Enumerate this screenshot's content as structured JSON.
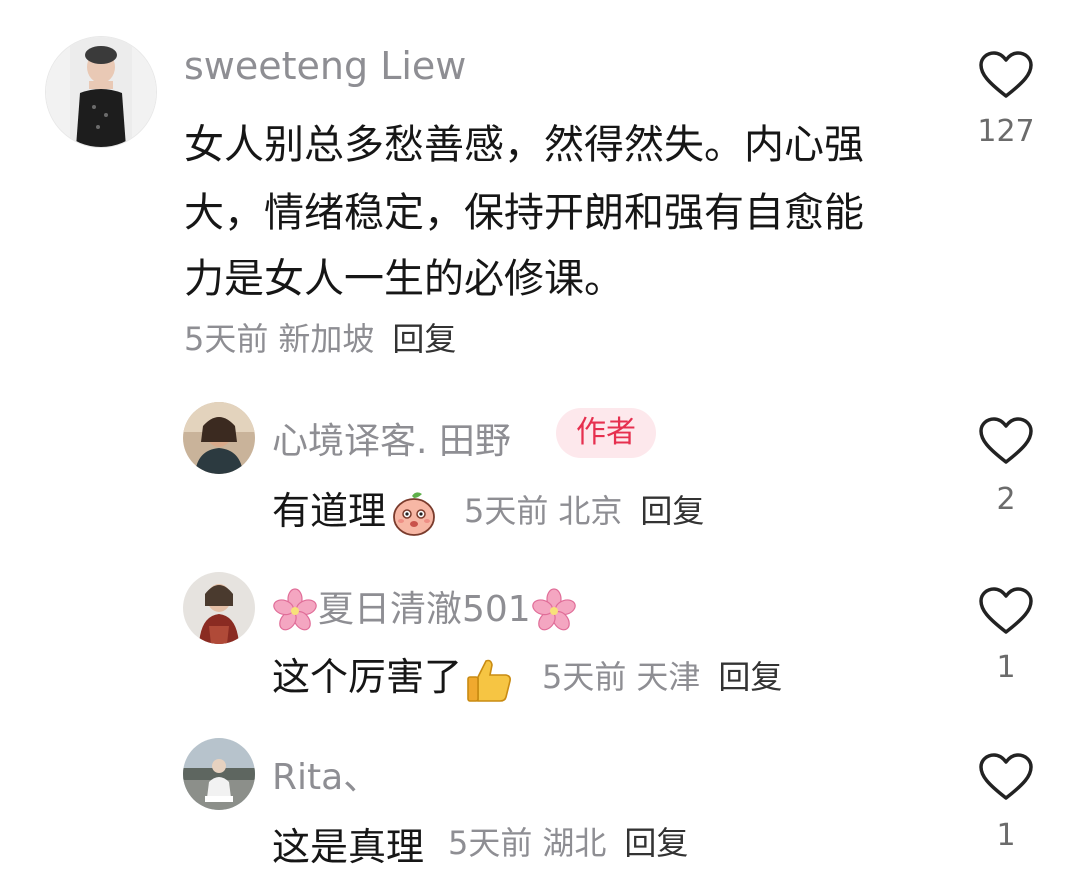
{
  "comments": [
    {
      "username": "sweeteng Liew",
      "text_lines": [
        "女人别总多愁善感，然得然失。内心强",
        "大，情绪稳定，保持开朗和强有自愈能",
        "力是女人一生的必修课。"
      ],
      "time": "5天前",
      "location": "新加坡",
      "reply_label": "回复",
      "likes": "127"
    }
  ],
  "replies": [
    {
      "username": "心境译客. 田野",
      "badge": "作者",
      "text": "有道理",
      "emoji": "peach-face-emoji",
      "time": "5天前",
      "location": "北京",
      "reply_label": "回复",
      "likes": "2"
    },
    {
      "username": "夏日清澈501",
      "username_decoration": "cherry-blossom",
      "text": "这个厉害了",
      "emoji": "thumbs-up-emoji",
      "time": "5天前",
      "location": "天津",
      "reply_label": "回复",
      "likes": "1"
    },
    {
      "username": "Rita、",
      "text": "这是真理",
      "time": "5天前",
      "location": "湖北",
      "reply_label": "回复",
      "likes": "1"
    }
  ],
  "colors": {
    "username": "#8e8e93",
    "text": "#161616",
    "badge_bg": "#fde8ec",
    "badge_text": "#e6304f"
  }
}
